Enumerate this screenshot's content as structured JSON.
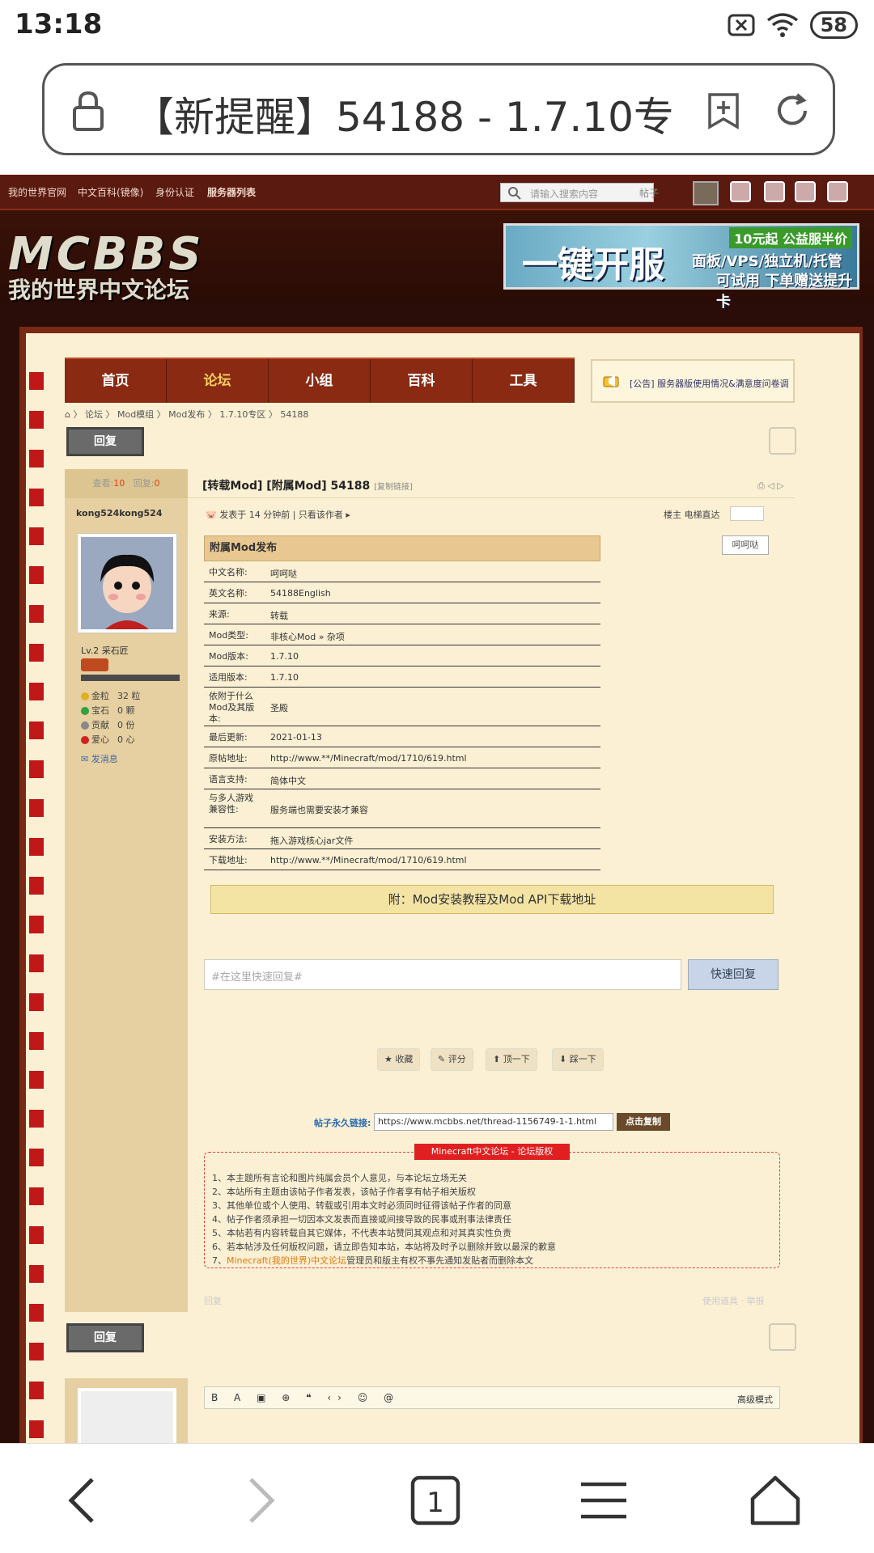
{
  "status_bar": {
    "time": "13:18",
    "battery": "58"
  },
  "browser": {
    "url_title": "【新提醒】54188 - 1.7.10专"
  },
  "topnav": {
    "items": [
      "我的世界官网",
      "中文百科(镜像)",
      "身份认证",
      "服务器列表"
    ],
    "search_placeholder": "请输入搜索内容",
    "search_type": "帖子"
  },
  "banner": {
    "logo_big": "MCBBS",
    "logo_small": "我的世界中文论坛",
    "ad_main": "一键开服",
    "ad_badge": "10元起 公益服半价",
    "ad_line1": "面板/VPS/独立机/托管",
    "ad_line2": "可试用 下单赠送提升卡"
  },
  "menu": {
    "items": [
      "首页",
      "论坛",
      "小组",
      "百科",
      "工具"
    ],
    "active_index": 1
  },
  "notice": "[公告] 服务器版使用情况&满意度问卷调",
  "breadcrumb": "⌂ 〉 论坛 〉 Mod模组 〉 Mod发布 〉 1.7.10专区 〉 54188",
  "reply_button": "回复",
  "stats": {
    "views_label": "查看:",
    "views": "10",
    "replies_label": "回复:",
    "replies": "0"
  },
  "author": {
    "name": "kong524kong524",
    "level": "Lv.2 采石匠",
    "gold": "金粒",
    "gold_val": "32 粒",
    "gem": "宝石",
    "gem_val": "0 颗",
    "contrib": "贡献",
    "contrib_val": "0 份",
    "love": "爱心",
    "love_val": "0 心",
    "send_msg": "发消息"
  },
  "post": {
    "title": "[转载Mod] [附属Mod] 54188",
    "copy_link": "[复制链接]",
    "meta": "发表于 14 分钟前  |  只看该作者",
    "floor": "楼主   电梯直达",
    "image_placeholder": "呵呵哒",
    "table_title": "附属Mod发布",
    "rows": [
      {
        "k": "中文名称:",
        "v": "呵呵哒"
      },
      {
        "k": "英文名称:",
        "v": "54188English"
      },
      {
        "k": "来源:",
        "v": "转载"
      },
      {
        "k": "Mod类型:",
        "v": "非核心Mod » 杂项"
      },
      {
        "k": "Mod版本:",
        "v": "1.7.10"
      },
      {
        "k": "适用版本:",
        "v": "1.7.10"
      },
      {
        "k": "依附于什么Mod及其版本:",
        "v": "圣殿"
      },
      {
        "k": "最后更新:",
        "v": "2021-01-13"
      },
      {
        "k": "原帖地址:",
        "v": "http://www.**/Minecraft/mod/1710/619.html"
      },
      {
        "k": "语言支持:",
        "v": "简体中文"
      },
      {
        "k": "与多人游戏兼容性:",
        "v": "服务端也需要安装才兼容"
      },
      {
        "k": "安装方法:",
        "v": "拖入游戏核心jar文件"
      },
      {
        "k": "下载地址:",
        "v": "http://www.**/Minecraft/mod/1710/619.html"
      }
    ],
    "attach_bar": "附：Mod安装教程及Mod API下载地址"
  },
  "quick_reply": {
    "placeholder": "#在这里快速回复#",
    "button": "快速回复"
  },
  "actions": [
    "收藏",
    "评分",
    "顶一下",
    "踩一下"
  ],
  "permalink": {
    "label": "帖子永久链接:",
    "url": "https://www.mcbbs.net/thread-1156749-1-1.html",
    "copy": "点击复制"
  },
  "copyright": {
    "title": "Minecraft中文论坛 - 论坛版权",
    "lines": [
      "1、本主题所有言论和图片纯属会员个人意见，与本论坛立场无关",
      "2、本站所有主题由该帖子作者发表，该帖子作者享有帖子相关版权",
      "3、其他单位或个人使用、转载或引用本文时必须同时征得该帖子作者的同意",
      "4、帖子作者须承担一切因本文发表而直接或间接导致的民事或刑事法律责任",
      "5、本帖若有内容转载自其它媒体，不代表本站赞同其观点和对其真实性负责",
      "6、若本帖涉及任何版权问题，请立即告知本站，本站将及时予以删除并致以最深的歉意"
    ],
    "line7_link": "Minecraft(我的世界)中文论坛",
    "line7_rest": "管理员和版主有权不事先通知发贴者而删除本文",
    "line7_prefix": "7、"
  },
  "post_footer": {
    "reply": "回复",
    "tools": "使用道具 ·   举报"
  },
  "editor": {
    "tools": "B A ▣ ⊕ ❝ ‹› ☺ @",
    "advanced": "高级模式"
  }
}
